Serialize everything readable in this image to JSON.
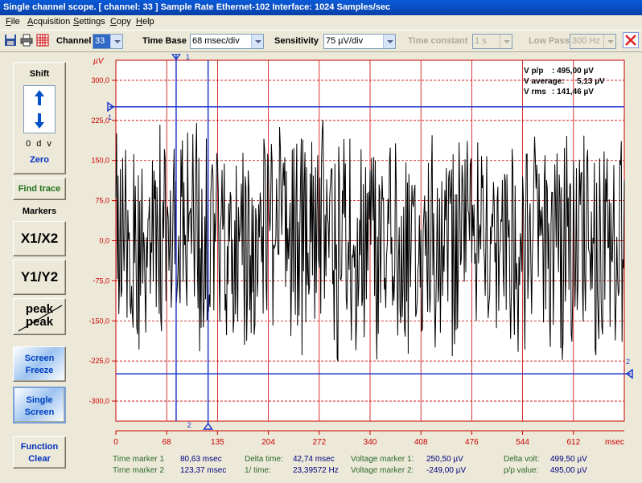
{
  "window": {
    "title": "Single channel scope. [ channel: 33 ]  Sample Rate Ethernet-102 Interface: 1024 Samples/sec"
  },
  "menu": {
    "items": [
      "File",
      "Acquisition",
      "Settings",
      "Copy",
      "Help"
    ]
  },
  "toolbar": {
    "channel_label": "Channel",
    "channel_value": "33",
    "timebase_label": "Time Base",
    "timebase_value": "68 msec/div",
    "sensitivity_label": "Sensitivity",
    "sensitivity_value": "75 µV/div",
    "timeconstant_label": "Time constant",
    "timeconstant_value": "1 s",
    "lowpass_label": "Low Pass",
    "lowpass_value": "300 Hz"
  },
  "left_panel": {
    "shift_label": "Shift",
    "div_readout": "0 d v",
    "zero_label": "Zero",
    "find_trace_label": "Find trace",
    "markers_label": "Markers",
    "x1x2_label": "X1/X2",
    "y1y2_label": "Y1/Y2",
    "peak_top": "peak",
    "peak_bottom": "peak",
    "screen_freeze_1": "Screen",
    "screen_freeze_2": "Freeze",
    "single_screen_1": "Single",
    "single_screen_2": "Screen",
    "function_clear_1": "Function",
    "function_clear_2": "Clear"
  },
  "scope": {
    "y_unit": "µV",
    "x_unit": "msec",
    "stats": {
      "vpp_label": "V p/p",
      "vpp_value": ":   495,00 µV",
      "vavg_label": "V average:",
      "vavg_value": "5,13 µV",
      "vrms_label": "V rms",
      "vrms_value": ":   141,46 µV"
    },
    "marker_labels": {
      "x1": "1",
      "x2": "2",
      "y1": "1",
      "y2": "2"
    }
  },
  "chart_data": {
    "type": "line",
    "x_ticks": [
      "0",
      "68",
      "135",
      "204",
      "272",
      "340",
      "408",
      "476",
      "544",
      "612"
    ],
    "y_ticks": [
      "300,0",
      "225,0",
      "150,0",
      "75,0",
      "0,0",
      "-75,0",
      "-150,0",
      "-225,0",
      "-300,0"
    ],
    "xlim": [
      0,
      680
    ],
    "ylim": [
      -337.5,
      337.5
    ],
    "grid": true,
    "markers": {
      "x1_msec": 80.63,
      "x2_msec": 123.37,
      "y1_uV": 250.5,
      "y2_uV": -249.0
    }
  },
  "status": {
    "tm1_label": "Time marker 1",
    "tm1_value": "80,63 msec",
    "tm2_label": "Time marker 2",
    "tm2_value": "123,37 msec",
    "dt_label": "Delta time:",
    "dt_value": "42,74 msec",
    "inv_label": "1/ time:",
    "inv_value": "23,39572 Hz",
    "vm1_label": "Voltage marker 1:",
    "vm1_value": "250,50 µV",
    "vm2_label": "Voltage marker 2:",
    "vm2_value": "-249,00 µV",
    "dv_label": "Delta volt:",
    "dv_value": "499,50 µV",
    "pp_label": "p/p value:",
    "pp_value": "495,00 µV"
  }
}
